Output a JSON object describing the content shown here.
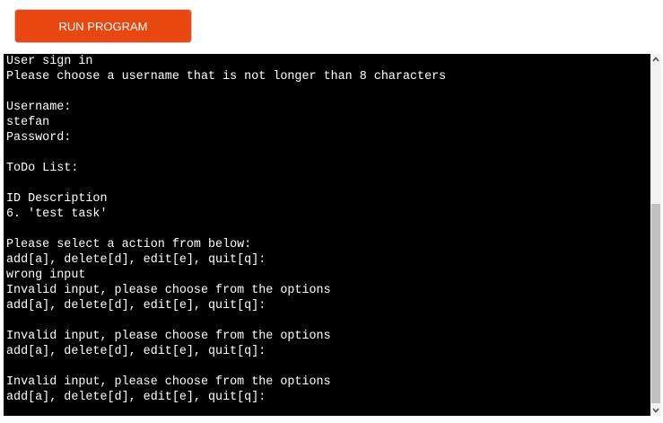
{
  "run_button": {
    "label": "RUN PROGRAM",
    "color": "#e8470f"
  },
  "terminal": {
    "background": "#000000",
    "text_color": "#ffffff",
    "lines": [
      "User sign in",
      "Please choose a username that is not longer than 8 characters",
      "",
      "Username:",
      "stefan",
      "Password:",
      "",
      "ToDo List:",
      "",
      "ID Description",
      "6. 'test task'",
      "",
      "Please select a action from below:",
      "add[a], delete[d], edit[e], quit[q]:",
      "wrong input",
      "Invalid input, please choose from the options",
      "add[a], delete[d], edit[e], quit[q]:",
      "",
      "Invalid input, please choose from the options",
      "add[a], delete[d], edit[e], quit[q]:",
      "",
      "Invalid input, please choose from the options",
      "add[a], delete[d], edit[e], quit[q]:"
    ]
  },
  "scrollbar": {
    "up_icon": "chevron-up-icon",
    "down_icon": "chevron-down-icon"
  }
}
